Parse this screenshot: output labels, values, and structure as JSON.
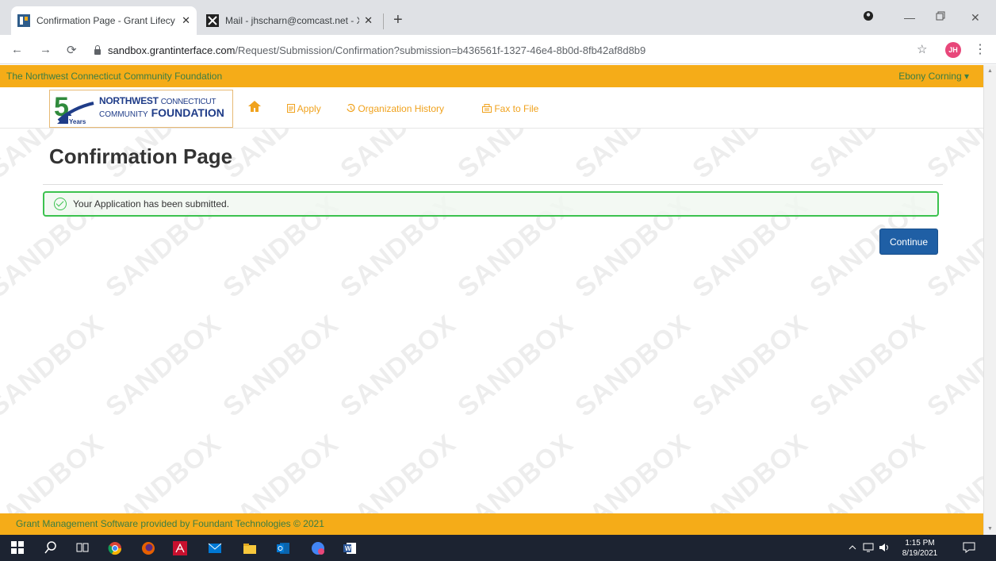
{
  "browser": {
    "tabs": [
      {
        "title": "Confirmation Page - Grant Lifecy",
        "close": "✕"
      },
      {
        "title": "Mail - jhscharn@comcast.net - X",
        "close": "✕"
      }
    ],
    "new_tab": "+",
    "url_host": "sandbox.grantinterface.com",
    "url_path": "/Request/Submission/Confirmation?submission=b436561f-1327-46e4-8b0d-8fb42af8d8b9",
    "profile_initials": "JH"
  },
  "site": {
    "org_name": "The Northwest Connecticut Community Foundation",
    "user_menu": "Ebony Corning ▾",
    "logo": {
      "years": "Years",
      "line1_bold": "NORTHWEST",
      "line1_rest": "CONNECTICUT",
      "line2_rest": "COMMUNITY",
      "line2_bold": "FOUNDATION"
    },
    "nav": {
      "apply": "Apply",
      "history": "Organization History",
      "fax": "Fax to File"
    }
  },
  "page": {
    "title": "Confirmation Page",
    "alert": "Your Application has been submitted.",
    "continue": "Continue",
    "watermark": "SANDBOX"
  },
  "footer": {
    "text": "Grant Management Software provided by Foundant Technologies © 2021"
  },
  "taskbar": {
    "time": "1:15 PM",
    "date": "8/19/2021"
  },
  "colors": {
    "orange": "#f5ac18",
    "green_text": "#3a7d44",
    "link_orange": "#f0a21d",
    "btn_blue": "#1f5fa5",
    "alert_green": "#3cc24f"
  }
}
